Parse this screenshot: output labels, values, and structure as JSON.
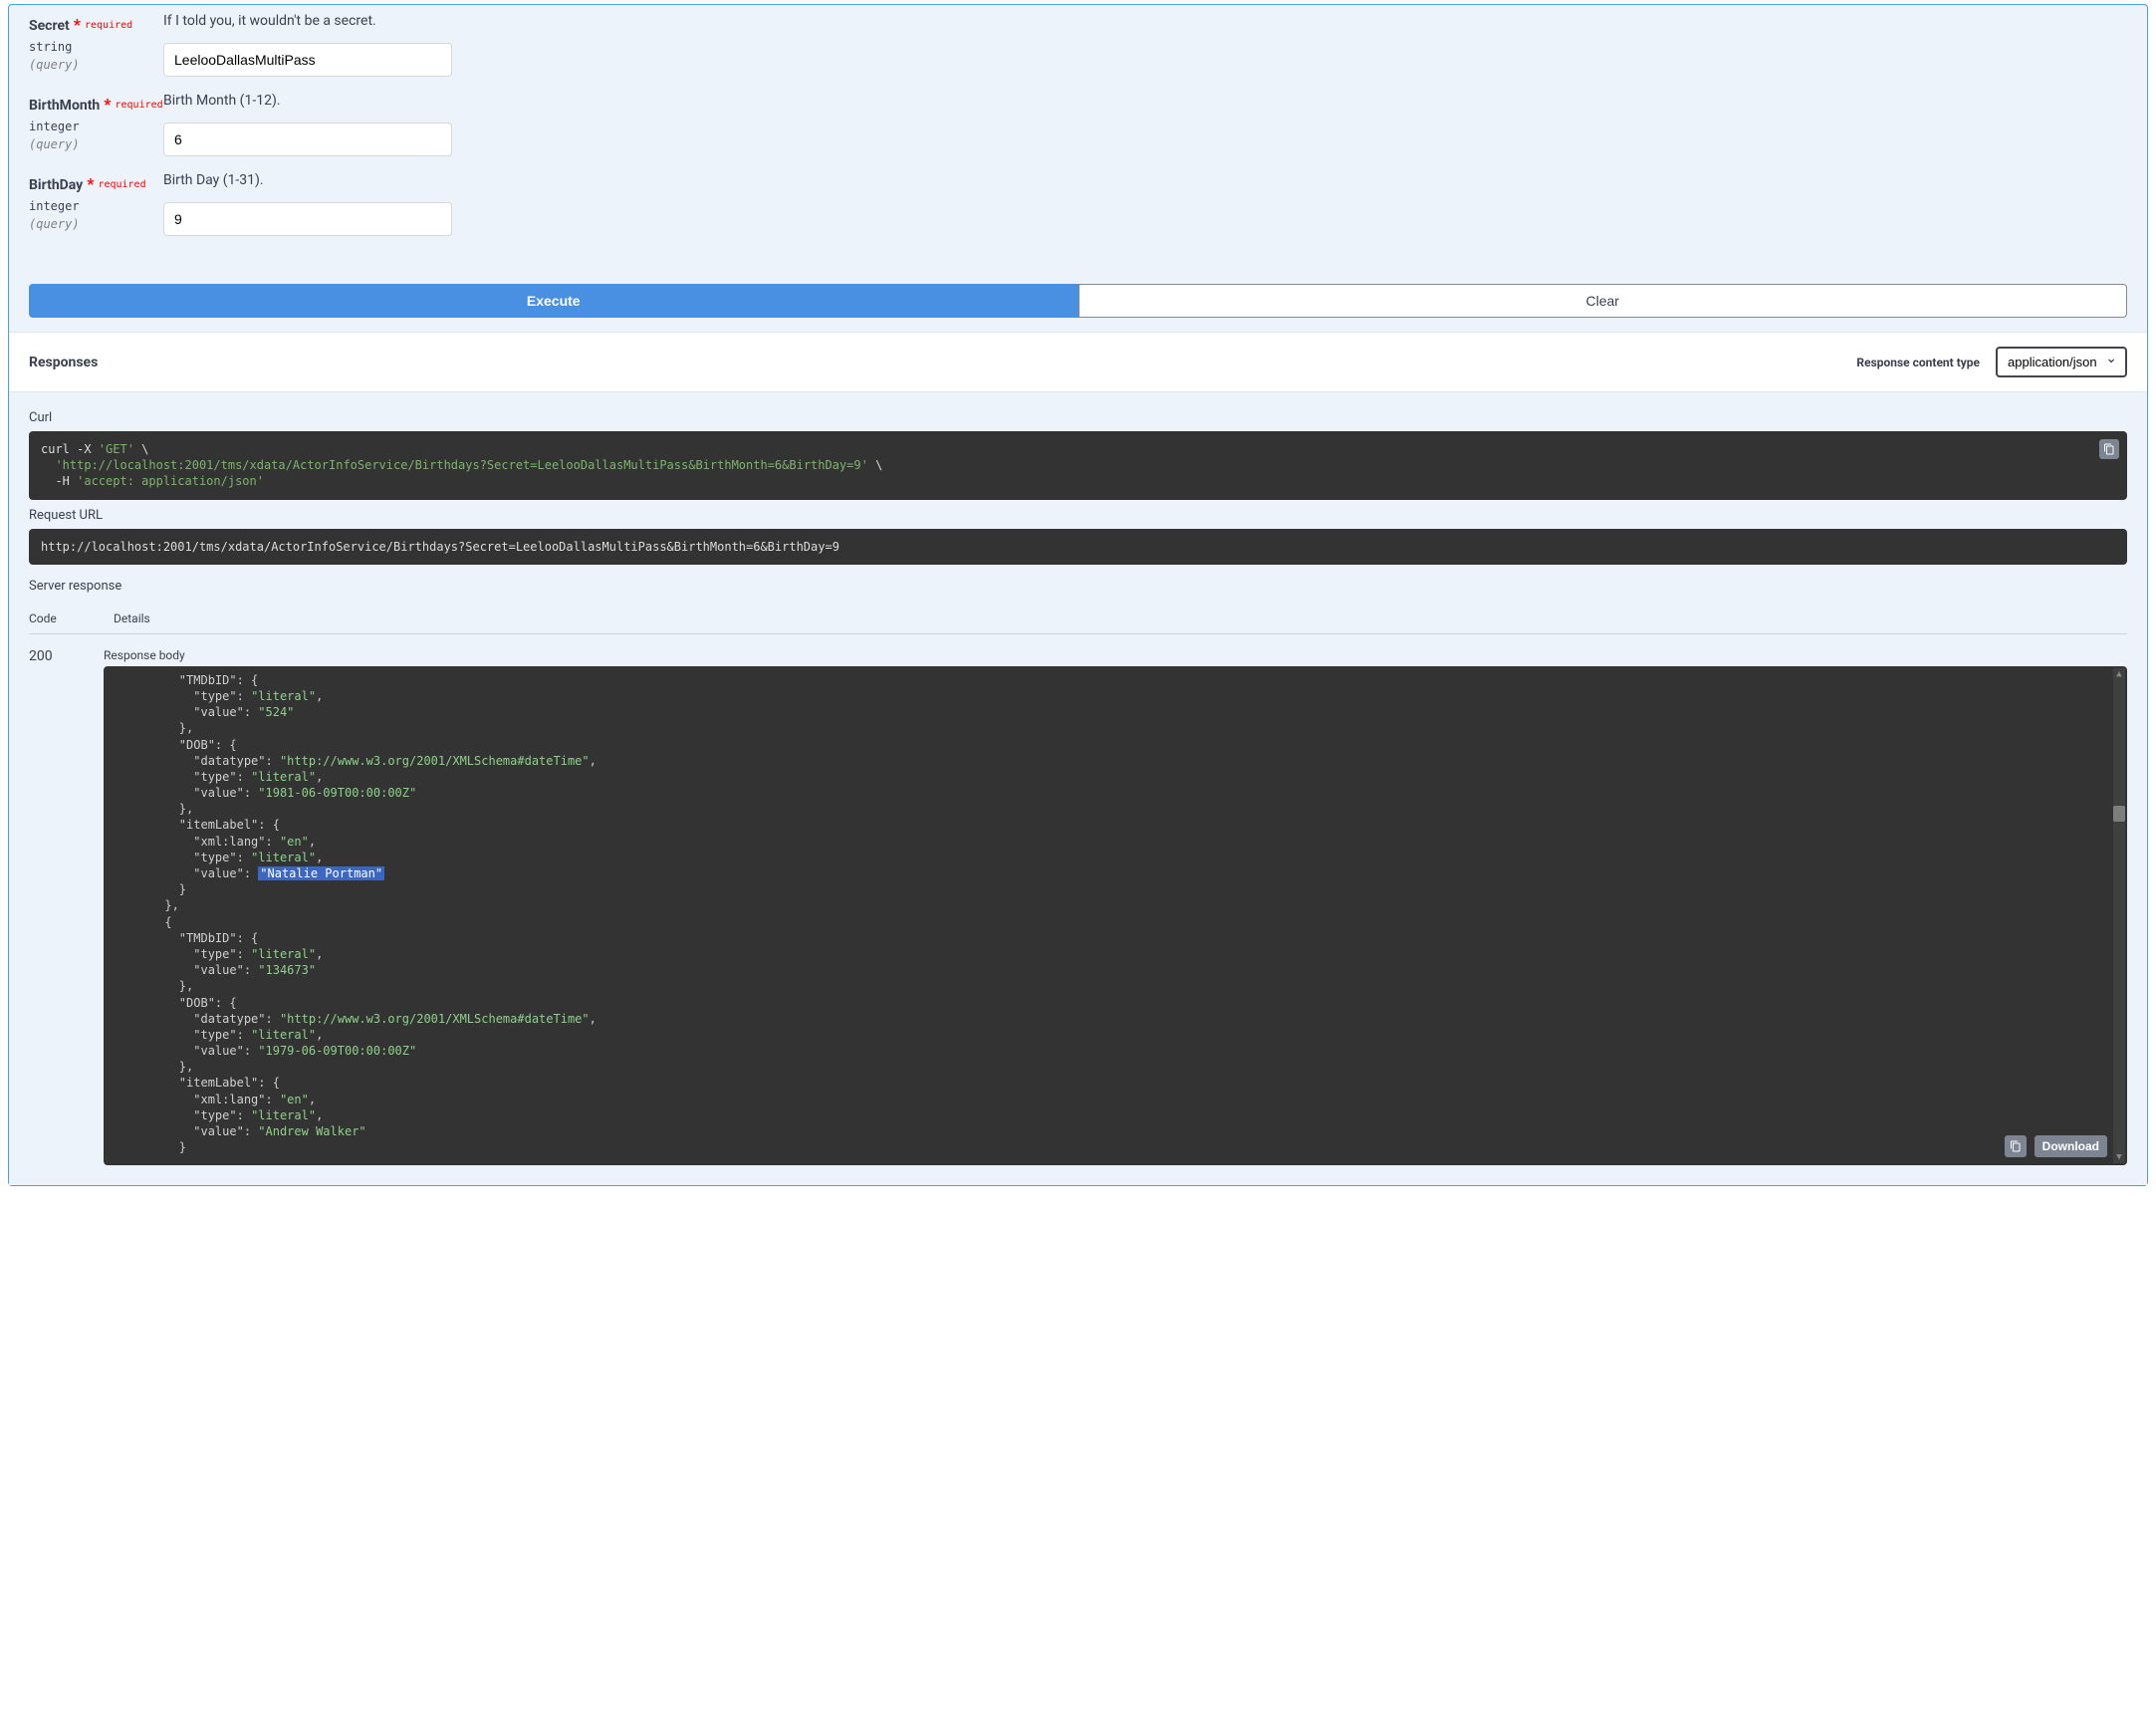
{
  "params": [
    {
      "name": "Secret",
      "required": "required",
      "type": "string",
      "in": "(query)",
      "desc": "If I told you, it wouldn't be a secret.",
      "value": "LeelooDallasMultiPass"
    },
    {
      "name": "BirthMonth",
      "required": "required",
      "type": "integer",
      "in": "(query)",
      "desc": "Birth Month (1-12).",
      "value": "6"
    },
    {
      "name": "BirthDay",
      "required": "required",
      "type": "integer",
      "in": "(query)",
      "desc": "Birth Day (1-31).",
      "value": "9"
    }
  ],
  "buttons": {
    "execute": "Execute",
    "clear": "Clear"
  },
  "responses": {
    "title": "Responses",
    "content_type_label": "Response content type",
    "content_type_value": "application/json"
  },
  "curl": {
    "label": "Curl",
    "cmd": "curl -X ",
    "verb": "'GET'",
    "url": "'http://localhost:2001/tms/xdata/ActorInfoService/Birthdays?Secret=LeelooDallasMultiPass&BirthMonth=6&BirthDay=9'",
    "header_flag": "-H ",
    "header_val": "'accept: application/json'"
  },
  "request_url": {
    "label": "Request URL",
    "value": "http://localhost:2001/tms/xdata/ActorInfoService/Birthdays?Secret=LeelooDallasMultiPass&BirthMonth=6&BirthDay=9"
  },
  "server_response": {
    "label": "Server response",
    "code_header": "Code",
    "details_header": "Details",
    "code": "200",
    "body_label": "Response body",
    "download": "Download"
  },
  "json_body": {
    "lines": [
      {
        "indent": 4,
        "text": "\"TMDbID\": {",
        "type": "key-brace"
      },
      {
        "indent": 5,
        "k": "\"type\"",
        "v": "\"literal\"",
        "comma": true
      },
      {
        "indent": 5,
        "k": "\"value\"",
        "v": "\"524\""
      },
      {
        "indent": 4,
        "text": "},",
        "type": "brace"
      },
      {
        "indent": 4,
        "text": "\"DOB\": {",
        "type": "key-brace"
      },
      {
        "indent": 5,
        "k": "\"datatype\"",
        "v": "\"http://www.w3.org/2001/XMLSchema#dateTime\"",
        "comma": true
      },
      {
        "indent": 5,
        "k": "\"type\"",
        "v": "\"literal\"",
        "comma": true
      },
      {
        "indent": 5,
        "k": "\"value\"",
        "v": "\"1981-06-09T00:00:00Z\""
      },
      {
        "indent": 4,
        "text": "},",
        "type": "brace"
      },
      {
        "indent": 4,
        "text": "\"itemLabel\": {",
        "type": "key-brace"
      },
      {
        "indent": 5,
        "k": "\"xml:lang\"",
        "v": "\"en\"",
        "comma": true
      },
      {
        "indent": 5,
        "k": "\"type\"",
        "v": "\"literal\"",
        "comma": true
      },
      {
        "indent": 5,
        "k": "\"value\"",
        "v": "\"Natalie Portman\"",
        "hl": true
      },
      {
        "indent": 4,
        "text": "}",
        "type": "brace"
      },
      {
        "indent": 3,
        "text": "},",
        "type": "brace"
      },
      {
        "indent": 3,
        "text": "{",
        "type": "brace"
      },
      {
        "indent": 4,
        "text": "\"TMDbID\": {",
        "type": "key-brace"
      },
      {
        "indent": 5,
        "k": "\"type\"",
        "v": "\"literal\"",
        "comma": true
      },
      {
        "indent": 5,
        "k": "\"value\"",
        "v": "\"134673\""
      },
      {
        "indent": 4,
        "text": "},",
        "type": "brace"
      },
      {
        "indent": 4,
        "text": "\"DOB\": {",
        "type": "key-brace"
      },
      {
        "indent": 5,
        "k": "\"datatype\"",
        "v": "\"http://www.w3.org/2001/XMLSchema#dateTime\"",
        "comma": true
      },
      {
        "indent": 5,
        "k": "\"type\"",
        "v": "\"literal\"",
        "comma": true
      },
      {
        "indent": 5,
        "k": "\"value\"",
        "v": "\"1979-06-09T00:00:00Z\""
      },
      {
        "indent": 4,
        "text": "},",
        "type": "brace"
      },
      {
        "indent": 4,
        "text": "\"itemLabel\": {",
        "type": "key-brace"
      },
      {
        "indent": 5,
        "k": "\"xml:lang\"",
        "v": "\"en\"",
        "comma": true
      },
      {
        "indent": 5,
        "k": "\"type\"",
        "v": "\"literal\"",
        "comma": true
      },
      {
        "indent": 5,
        "k": "\"value\"",
        "v": "\"Andrew Walker\""
      },
      {
        "indent": 4,
        "text": "}",
        "type": "brace"
      }
    ]
  }
}
